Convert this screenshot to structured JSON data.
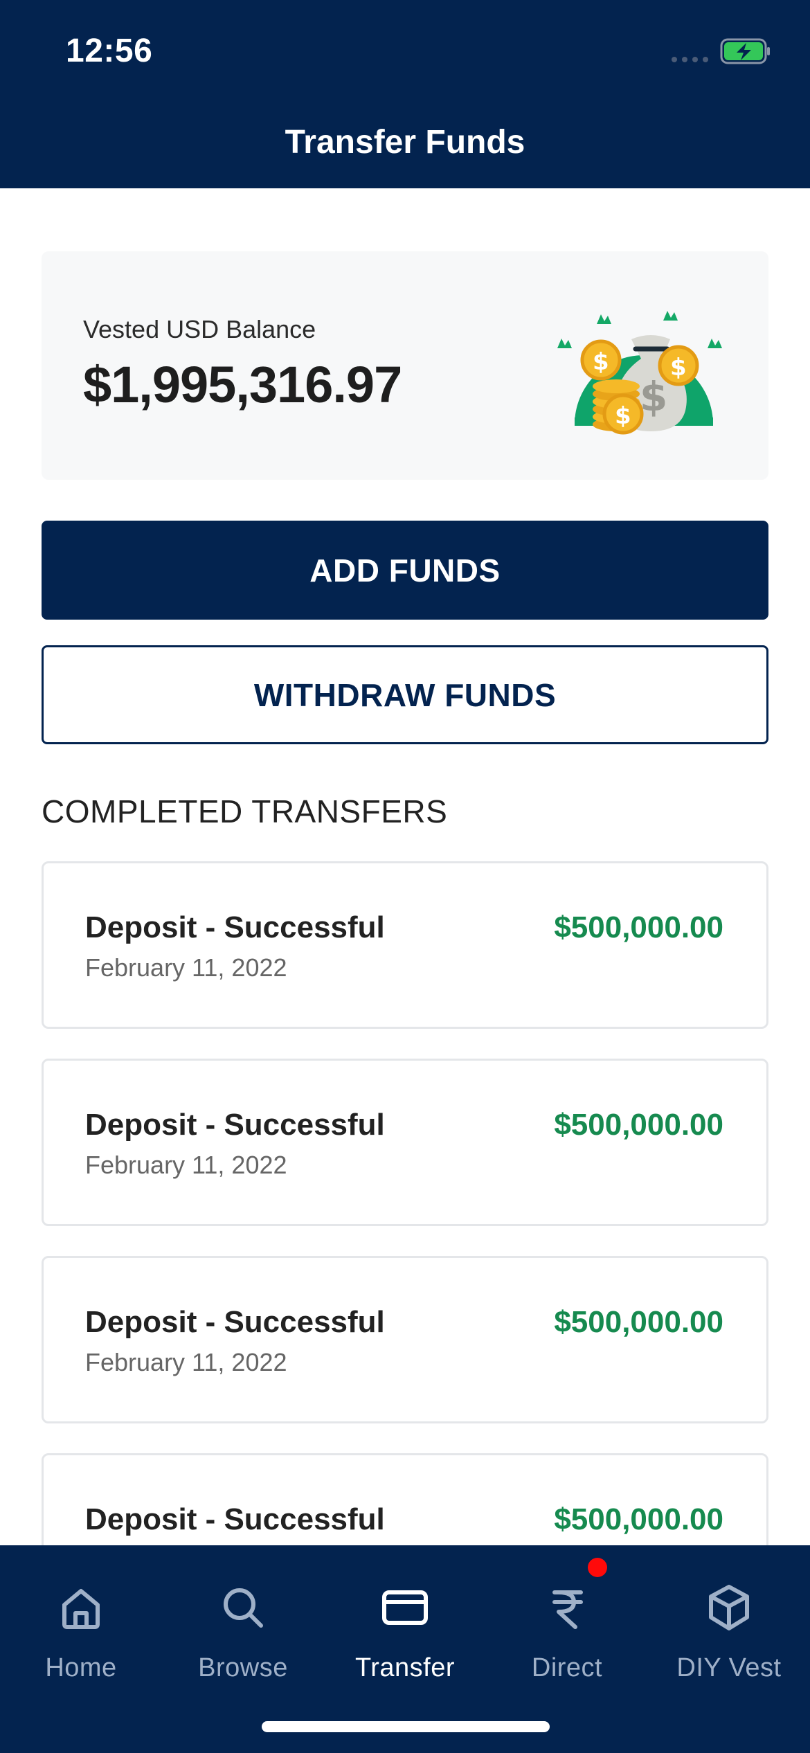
{
  "status_bar": {
    "time": "12:56"
  },
  "header": {
    "title": "Transfer Funds"
  },
  "balance": {
    "label": "Vested USD Balance",
    "value": "$1,995,316.97"
  },
  "actions": {
    "add_funds": "ADD FUNDS",
    "withdraw_funds": "WITHDRAW FUNDS"
  },
  "transfers": {
    "title": "COMPLETED TRANSFERS",
    "items": [
      {
        "title": "Deposit - Successful",
        "date": "February 11, 2022",
        "amount": "$500,000.00"
      },
      {
        "title": "Deposit - Successful",
        "date": "February 11, 2022",
        "amount": "$500,000.00"
      },
      {
        "title": "Deposit - Successful",
        "date": "February 11, 2022",
        "amount": "$500,000.00"
      },
      {
        "title": "Deposit - Successful",
        "date": "",
        "amount": "$500,000.00"
      }
    ]
  },
  "nav": {
    "items": [
      {
        "label": "Home",
        "icon": "home-icon"
      },
      {
        "label": "Browse",
        "icon": "search-icon"
      },
      {
        "label": "Transfer",
        "icon": "card-icon",
        "active": true
      },
      {
        "label": "Direct",
        "icon": "rupee-icon"
      },
      {
        "label": "DIY Vest",
        "icon": "cube-icon"
      }
    ]
  },
  "colors": {
    "primary": "#03234f",
    "positive": "#168a4f",
    "notification": "#ff0a0a"
  }
}
